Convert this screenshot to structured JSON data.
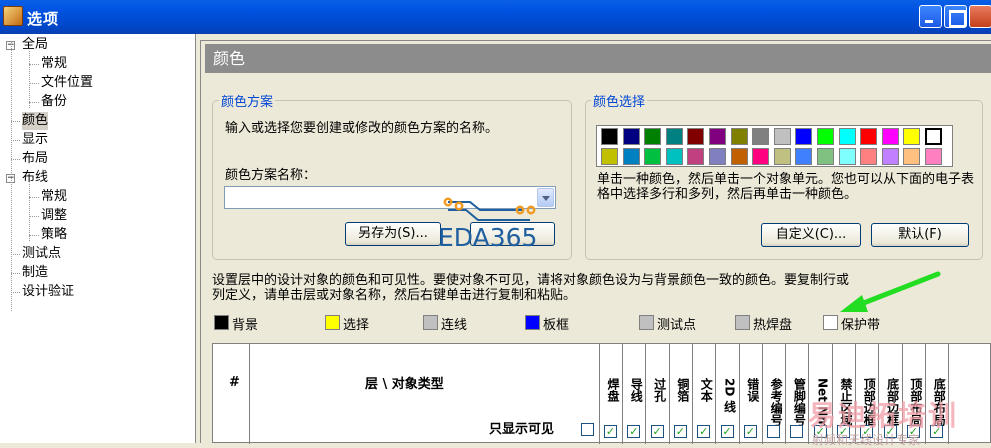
{
  "window": {
    "title": "选项"
  },
  "tree": {
    "items": [
      {
        "label": "全局",
        "level": 0,
        "toggle": "−"
      },
      {
        "label": "常规",
        "level": 1
      },
      {
        "label": "文件位置",
        "level": 1
      },
      {
        "label": "备份",
        "level": 1
      },
      {
        "label": "颜色",
        "level": 0,
        "selected": true
      },
      {
        "label": "显示",
        "level": 0
      },
      {
        "label": "布局",
        "level": 0
      },
      {
        "label": "布线",
        "level": 0,
        "toggle": "−"
      },
      {
        "label": "常规",
        "level": 1
      },
      {
        "label": "调整",
        "level": 1
      },
      {
        "label": "策略",
        "level": 1
      },
      {
        "label": "测试点",
        "level": 0
      },
      {
        "label": "制造",
        "level": 0
      },
      {
        "label": "设计验证",
        "level": 0
      }
    ]
  },
  "panel": {
    "header": "颜色"
  },
  "scheme": {
    "title": "颜色方案",
    "desc": "输入或选择您要创建或修改的颜色方案的名称。",
    "name_label": "颜色方案名称：",
    "name_value": "",
    "save_as": "另存为(S)...",
    "delete": "删除"
  },
  "picker": {
    "title": "颜色选择",
    "colors_row1": [
      "#000000",
      "#000080",
      "#008000",
      "#008080",
      "#800000",
      "#800080",
      "#808000",
      "#808080",
      "#c0c0c0",
      "#0000ff",
      "#00ff00",
      "#00ffff",
      "#ff0000",
      "#ff00ff",
      "#ffff00",
      "#ffffff"
    ],
    "colors_row2": [
      "#c0c000",
      "#0080c0",
      "#00c040",
      "#00c0c0",
      "#c04080",
      "#8080c0",
      "#c06000",
      "#ff0080",
      "#c0c080",
      "#4080ff",
      "#80c080",
      "#80ffff",
      "#ff8080",
      "#c080ff",
      "#ffc080",
      "#ff80c0"
    ],
    "note": "单击一种颜色，然后单击一个对象单元。您也可以从下面的电子表格中选择多行和多列，然后再单击一种颜色。",
    "custom": "自定义(C)...",
    "default": "默认(F)"
  },
  "visibility_note": "设置层中的设计对象的颜色和可见性。要使对象不可见，请将对象颜色设为与背景颜色一致的颜色。要复制行或列定义，请单击层或对象名称，然后右键单击进行复制和粘贴。",
  "legend": [
    {
      "label": "背景",
      "color": "#000000"
    },
    {
      "label": "选择",
      "color": "#ffff00"
    },
    {
      "label": "连线",
      "color": "#c0c0c0"
    },
    {
      "label": "板框",
      "color": "#0000ff"
    },
    {
      "label": "测试点",
      "color": "#c0c0c0"
    },
    {
      "label": "热焊盘",
      "color": "#c0c0c0"
    },
    {
      "label": "保护带",
      "color": "#ffffff"
    }
  ],
  "grid": {
    "num_header": "#",
    "layer_header": "层 \\ 对象类型",
    "visible_only": "只显示可见",
    "visible_only_checked": false,
    "columns": [
      {
        "label": "焊盘",
        "checked": true
      },
      {
        "label": "导线",
        "checked": true
      },
      {
        "label": "过孔",
        "checked": true
      },
      {
        "label": "铜箔",
        "checked": true
      },
      {
        "label": "文本",
        "checked": true
      },
      {
        "label": "2D 线",
        "checked": true
      },
      {
        "label": "错误",
        "checked": true
      },
      {
        "label": "参考编号",
        "checked": false
      },
      {
        "label": "管脚编号",
        "checked": false
      },
      {
        "label": "Net Nm.",
        "checked": true
      },
      {
        "label": "禁止区域",
        "checked": true
      },
      {
        "label": "顶部边框",
        "checked": true
      },
      {
        "label": "底部边框",
        "checked": true
      },
      {
        "label": "顶部布局",
        "checked": true
      },
      {
        "label": "底部布局",
        "checked": true
      }
    ]
  },
  "branding": {
    "logo": "EDA365",
    "watermark": "易迪拓培训",
    "watermark_sub": "射频和天线设计专家"
  }
}
